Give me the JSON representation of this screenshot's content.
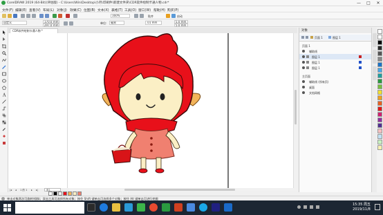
{
  "window": {
    "title": "CorelDRAW 2019 (64-Bit)(评估版) - C:\\Users\\Win\\Desktop\\小月\\印刷件\\新建文件夹\\CDR软件绘制卡通人物.cdr*",
    "controls": [
      "—",
      "□",
      "✕"
    ]
  },
  "menu": {
    "items": [
      "文件(F)",
      "编辑(E)",
      "查看(V)",
      "布局(L)",
      "对象(J)",
      "效果(C)",
      "位图(B)",
      "文本(X)",
      "表格(T)",
      "工具(O)",
      "窗口(W)",
      "帮助(H)",
      "购买(P)"
    ]
  },
  "toolbar": {
    "zoom_value": "160%",
    "snap_label": "贴齐",
    "launch_label": "启动"
  },
  "propbar": {
    "page_preset": "自定义",
    "width": "170.0 mm",
    "height": "297.0 mm",
    "units_label": "单位:",
    "units_value": "毫米",
    "nudge": ".01 mm",
    "dup_x": "5.0 mm",
    "dup_y": "5.0 mm"
  },
  "document": {
    "tab_label": "CDR软件绘制卡通人物 *"
  },
  "pagenav": {
    "page_of": "1 的 1",
    "page_name": "页1"
  },
  "docker": {
    "title": "对象",
    "page_label": "页面 1",
    "layer_label": "图层 1",
    "rows": [
      {
        "label": "页面 1",
        "indent": 2
      },
      {
        "label": "辅助线",
        "indent": 8
      },
      {
        "label": "图层 1",
        "indent": 8
      },
      {
        "label": "图层 1",
        "indent": 8
      },
      {
        "label": "图层 1",
        "indent": 8
      },
      {
        "label": "主页面",
        "indent": 2
      },
      {
        "label": "辅助线 (所有页)",
        "indent": 8
      },
      {
        "label": "桌面",
        "indent": 8
      },
      {
        "label": "文档网格",
        "indent": 8
      }
    ]
  },
  "status": {
    "text": "单击对象两次可旋转/倾斜；双击工具可选择所有对象；按住 Shift 键单击可选择多个对象；按住 Alt 键单击可进行挖掘"
  },
  "taskbar": {
    "time": "15:35 周五",
    "date": "2019/11/8"
  },
  "colors": {
    "hood": "#e8101a",
    "face": "#fbefc5",
    "dress": "#f08070",
    "hair": "#f2b45a",
    "taskbar": "#1c2633"
  }
}
